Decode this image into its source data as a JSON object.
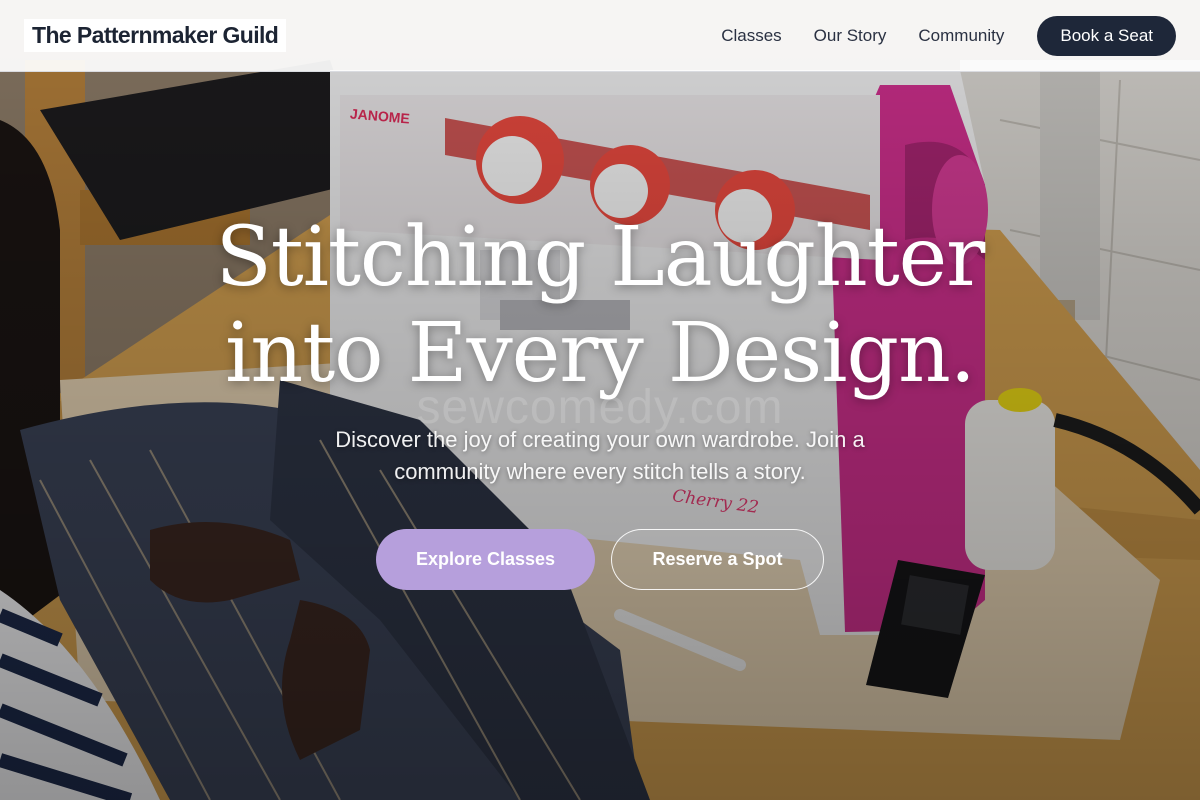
{
  "nav": {
    "brand": "The Patternmaker Guild",
    "links": [
      "Classes",
      "Our Story",
      "Community"
    ],
    "cta": "Book a Seat"
  },
  "hero": {
    "headline_line1": "Stitching Laughter",
    "headline_line2": "into Every Design.",
    "watermark": "sewcomedy.com",
    "subtext": "Discover the joy of creating your own wardrobe. Join a community where every stitch tells a story.",
    "primary_cta": "Explore Classes",
    "secondary_cta": "Reserve a Spot",
    "machine_brand": "JANOME",
    "machine_model": "Cherry 22"
  },
  "colors": {
    "nav_bg": "#ffffff",
    "dark": "#1e2739",
    "accent_lavender": "#b69fdc",
    "machine_pink": "#cc2f8b",
    "dial_red": "#e8493f"
  }
}
